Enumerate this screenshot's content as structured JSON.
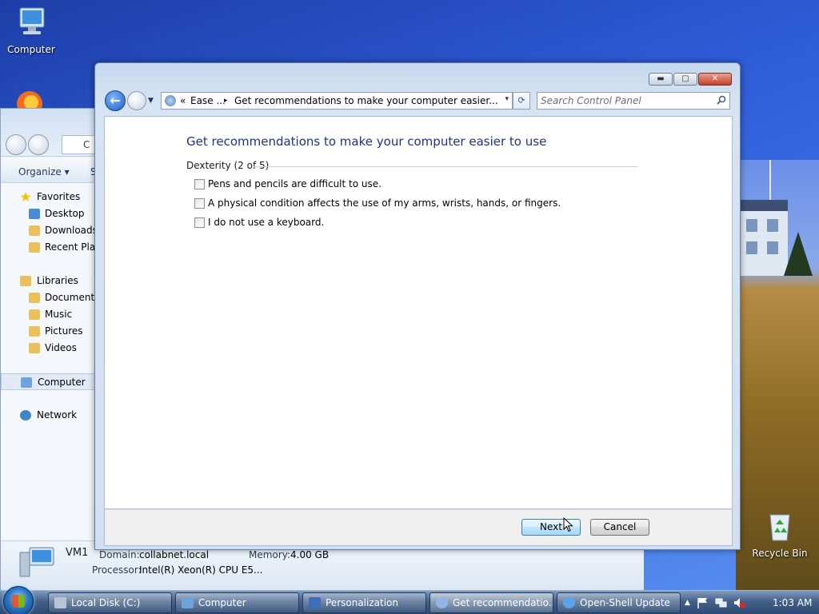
{
  "desktop": {
    "icons": {
      "computer": "Computer",
      "recycle_bin": "Recycle Bin"
    }
  },
  "explorer": {
    "address_partial": "C",
    "toolbar": {
      "organize": "Organize ▾",
      "system_partial": "Sy"
    },
    "nav": {
      "favorites": "Favorites",
      "desktop": "Desktop",
      "downloads": "Downloads",
      "recent_places": "Recent Place",
      "libraries": "Libraries",
      "documents": "Documents",
      "music": "Music",
      "pictures": "Pictures",
      "videos": "Videos",
      "computer": "Computer",
      "network": "Network"
    },
    "details": {
      "name": "VM1",
      "domain_label": "Domain:",
      "domain_value": "collabnet.local",
      "memory_label": "Memory:",
      "memory_value": "4.00 GB",
      "processor_label": "Processor:",
      "processor_value": "Intel(R) Xeon(R) CPU E5..."
    }
  },
  "window": {
    "caption": {
      "minimize": "▬",
      "maximize": "▢",
      "close": "✕"
    },
    "address": {
      "chevrons": "«",
      "crumb1": "Ease ...",
      "sep": "▸",
      "crumb2": "Get recommendations to make your computer easier...",
      "dropdown": "▾"
    },
    "refresh": "⟳",
    "search_placeholder": "Search Control Panel",
    "page_title": "Get recommendations to make your computer easier to use",
    "section": "Dexterity (2 of 5)",
    "options": [
      {
        "label": "Pens and pencils are difficult to use.",
        "checked": false
      },
      {
        "label": "A physical condition affects the use of my arms, wrists, hands, or fingers.",
        "checked": false
      },
      {
        "label": "I do not use a keyboard.",
        "checked": false
      }
    ],
    "buttons": {
      "next": "Next",
      "cancel": "Cancel"
    }
  },
  "taskbar": {
    "items": [
      {
        "label": "Local Disk (C:)",
        "active": false
      },
      {
        "label": "Computer",
        "active": false
      },
      {
        "label": "Personalization",
        "active": false
      },
      {
        "label": "Get recommendatio...",
        "active": true
      },
      {
        "label": "Open-Shell Update",
        "active": false
      }
    ],
    "tray_expand": "▲",
    "clock": "1:03 AM"
  }
}
